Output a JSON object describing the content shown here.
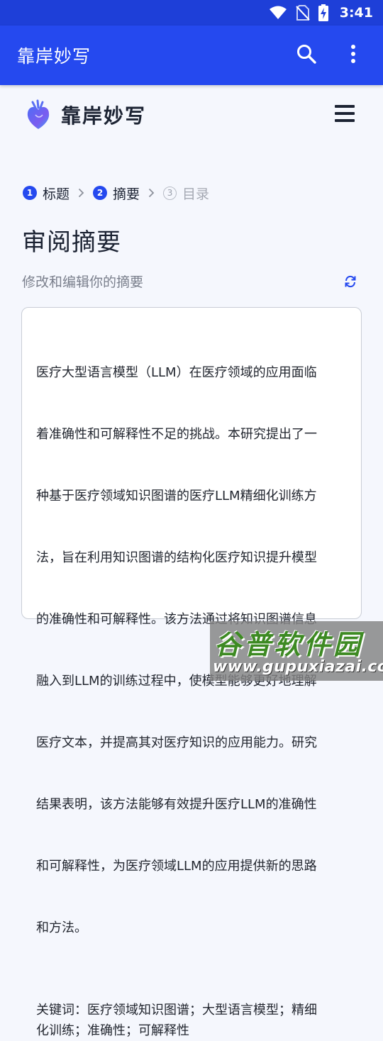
{
  "status_bar": {
    "time": "3:41"
  },
  "app_bar": {
    "title": "靠岸妙写",
    "search_icon": "search-icon",
    "more_icon": "more-vert-icon"
  },
  "brand": {
    "name": "靠岸妙写",
    "logo_icon": "heart-logo-icon",
    "menu_icon": "hamburger-menu-icon"
  },
  "steps": [
    {
      "number": "1",
      "label": "标题",
      "state": "done"
    },
    {
      "number": "2",
      "label": "摘要",
      "state": "active"
    },
    {
      "number": "3",
      "label": "目录",
      "state": "inactive"
    }
  ],
  "page": {
    "title": "审阅摘要",
    "subtitle": "修改和编辑你的摘要",
    "refresh_icon": "refresh-icon"
  },
  "abstract": {
    "lines": [
      "医疗大型语言模型（LLM）在医疗领域的应用面临",
      "着准确性和可解释性不足的挑战。本研究提出了一",
      "种基于医疗领域知识图谱的医疗LLM精细化训练方",
      "法，旨在利用知识图谱的结构化医疗知识提升模型",
      "的准确性和可解释性。该方法通过将知识图谱信息",
      "融入到LLM的训练过程中，使模型能够更好地理解",
      "医疗文本，并提高其对医疗知识的应用能力。研究",
      "结果表明，该方法能够有效提升医疗LLM的准确性",
      "和可解释性，为医疗领域LLM的应用提供新的思路",
      "和方法。"
    ],
    "keywords_lines": [
      "关键词：医疗领域知识图谱；大型语言模型；精细",
      "化训练；准确性；可解释性"
    ]
  },
  "watermark": {
    "title": "谷普软件园",
    "url": "www.gupuxiazai.com"
  },
  "colors": {
    "status_bar": "#1e3fd8",
    "app_bar": "#2549ef",
    "accent": "#2549ef",
    "background": "#f5f7fd"
  }
}
